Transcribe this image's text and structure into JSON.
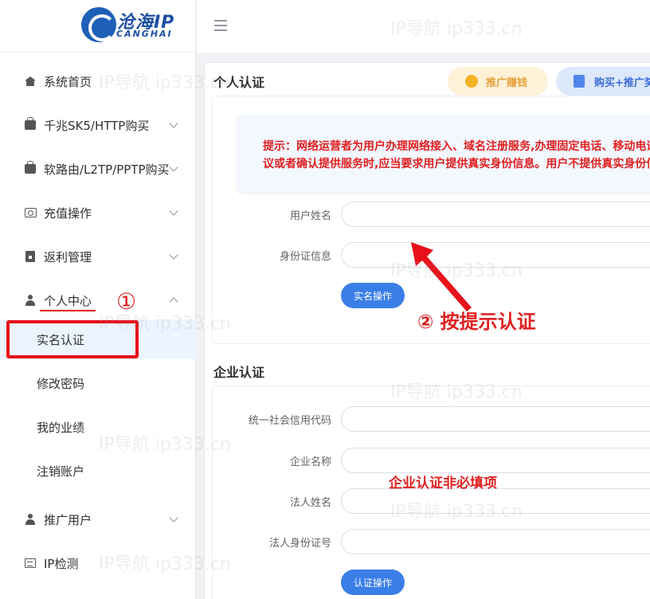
{
  "brand": {
    "name": "沧海IP",
    "sub": "CANGHAI"
  },
  "sidebar": {
    "items": [
      {
        "label": "系统首页",
        "icon": "home-icon"
      },
      {
        "label": "千兆SK5/HTTP购买",
        "icon": "shopping-bag-icon"
      },
      {
        "label": "软路由/L2TP/PPTP购买",
        "icon": "shopping-bag-icon"
      },
      {
        "label": "充值操作",
        "icon": "wallet-icon"
      },
      {
        "label": "返利管理",
        "icon": "box-icon"
      },
      {
        "label": "个人中心",
        "icon": "user-icon"
      },
      {
        "label": "推广用户",
        "icon": "user-icon"
      },
      {
        "label": "IP检测",
        "icon": "document-icon"
      }
    ],
    "sub_items": [
      {
        "label": "实名认证",
        "active": true
      },
      {
        "label": "修改密码"
      },
      {
        "label": "我的业绩"
      },
      {
        "label": "注销账户"
      }
    ]
  },
  "toolbar": {
    "promo_label": "推广赚钱",
    "buy_label": "购买+推广奖"
  },
  "personal": {
    "title": "个人认证",
    "notice_line1": "提示：网络运营者为用户办理网络接入、域名注册服务,办理固定电话、移动电话等入网手续,或者为用户提供信息发布、即时通讯等服务,在与用户签订协",
    "notice_line2": "议或者确认提供服务时,应当要求用户提供真实身份信息。用户不提供真实身份信息的,网络运营者不得为其提供相关服务",
    "name_label": "用户姓名",
    "id_label": "身份证信息",
    "submit_label": "实名操作"
  },
  "enterprise": {
    "title": "企业认证",
    "credit_label": "统一社会信用代码",
    "company_label": "企业名称",
    "legal_name_label": "法人姓名",
    "legal_id_label": "法人身份证号",
    "submit_label": "认证操作"
  },
  "annotations": {
    "step1": "①",
    "step2": "② 按提示认证",
    "optional_note": "企业认证非必填项"
  },
  "watermark": "IP导航  ip333.cn"
}
